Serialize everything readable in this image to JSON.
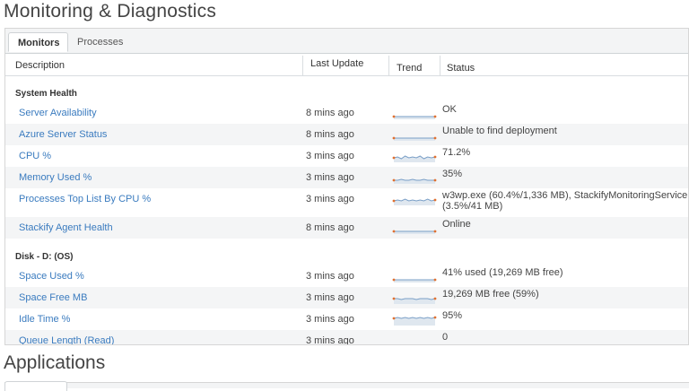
{
  "page": {
    "title": "Monitoring & Diagnostics"
  },
  "tabs": [
    {
      "label": "Monitors",
      "active": true
    },
    {
      "label": "Processes",
      "active": false
    }
  ],
  "table": {
    "headers": {
      "description": "Description",
      "last_update": "Last Update",
      "trend": "Trend",
      "status": "Status"
    },
    "groups": [
      {
        "title": "System Health",
        "rows": [
          {
            "description": "Server Availability",
            "last_update": "8 mins ago",
            "status": "OK",
            "trend": [
              3,
              3,
              3,
              3,
              3,
              3,
              3,
              3,
              3,
              3,
              3,
              3
            ]
          },
          {
            "description": "Azure Server Status",
            "last_update": "8 mins ago",
            "status": "Unable to find deployment",
            "trend": [
              3,
              3,
              3,
              3,
              3,
              3,
              3,
              3,
              3,
              3,
              3,
              3
            ]
          },
          {
            "description": "CPU %",
            "last_update": "3 mins ago",
            "status": "71.2%",
            "trend": [
              5,
              6,
              4,
              7,
              5,
              6,
              5,
              7,
              4,
              6,
              5,
              6
            ]
          },
          {
            "description": "Memory Used %",
            "last_update": "3 mins ago",
            "status": "35%",
            "trend": [
              4,
              4,
              5,
              4,
              4,
              5,
              4,
              4,
              5,
              4,
              4,
              4
            ]
          },
          {
            "description": "Processes Top List By CPU %",
            "last_update": "3 mins ago",
            "status": "w3wp.exe (60.4%/1,336 MB), StackifyMonitoringService (3.5%/41 MB)",
            "trend": [
              5,
              6,
              5,
              7,
              5,
              6,
              5,
              6,
              5,
              7,
              5,
              6
            ]
          },
          {
            "description": "Stackify Agent Health",
            "last_update": "8 mins ago",
            "status": "Online",
            "trend": [
              3,
              3,
              3,
              3,
              3,
              3,
              3,
              3,
              3,
              3,
              3,
              3
            ]
          }
        ]
      },
      {
        "title": "Disk - D: (OS)",
        "rows": [
          {
            "description": "Space Used %",
            "last_update": "3 mins ago",
            "status": "41% used (19,269 MB free)",
            "trend": [
              3,
              3,
              3,
              3,
              3,
              3,
              3,
              3,
              3,
              3,
              3,
              3
            ]
          },
          {
            "description": "Space Free MB",
            "last_update": "3 mins ago",
            "status": "19,269 MB free (59%)",
            "trend": [
              6,
              6,
              5,
              6,
              6,
              6,
              5,
              6,
              6,
              6,
              5,
              6
            ]
          },
          {
            "description": "Idle Time %",
            "last_update": "3 mins ago",
            "status": "95%",
            "trend": [
              8,
              9,
              8,
              9,
              8,
              9,
              8,
              9,
              8,
              9,
              8,
              9
            ]
          },
          {
            "description": "Queue Length (Read)",
            "last_update": "3 mins ago",
            "status": "0",
            "trend": []
          }
        ]
      }
    ]
  },
  "section2": {
    "title": "Applications"
  },
  "colors": {
    "link": "#3a7bbf",
    "trend_line": "#7a9fc7",
    "trend_fill": "#dfe7ef",
    "trend_marker": "#e07030"
  }
}
